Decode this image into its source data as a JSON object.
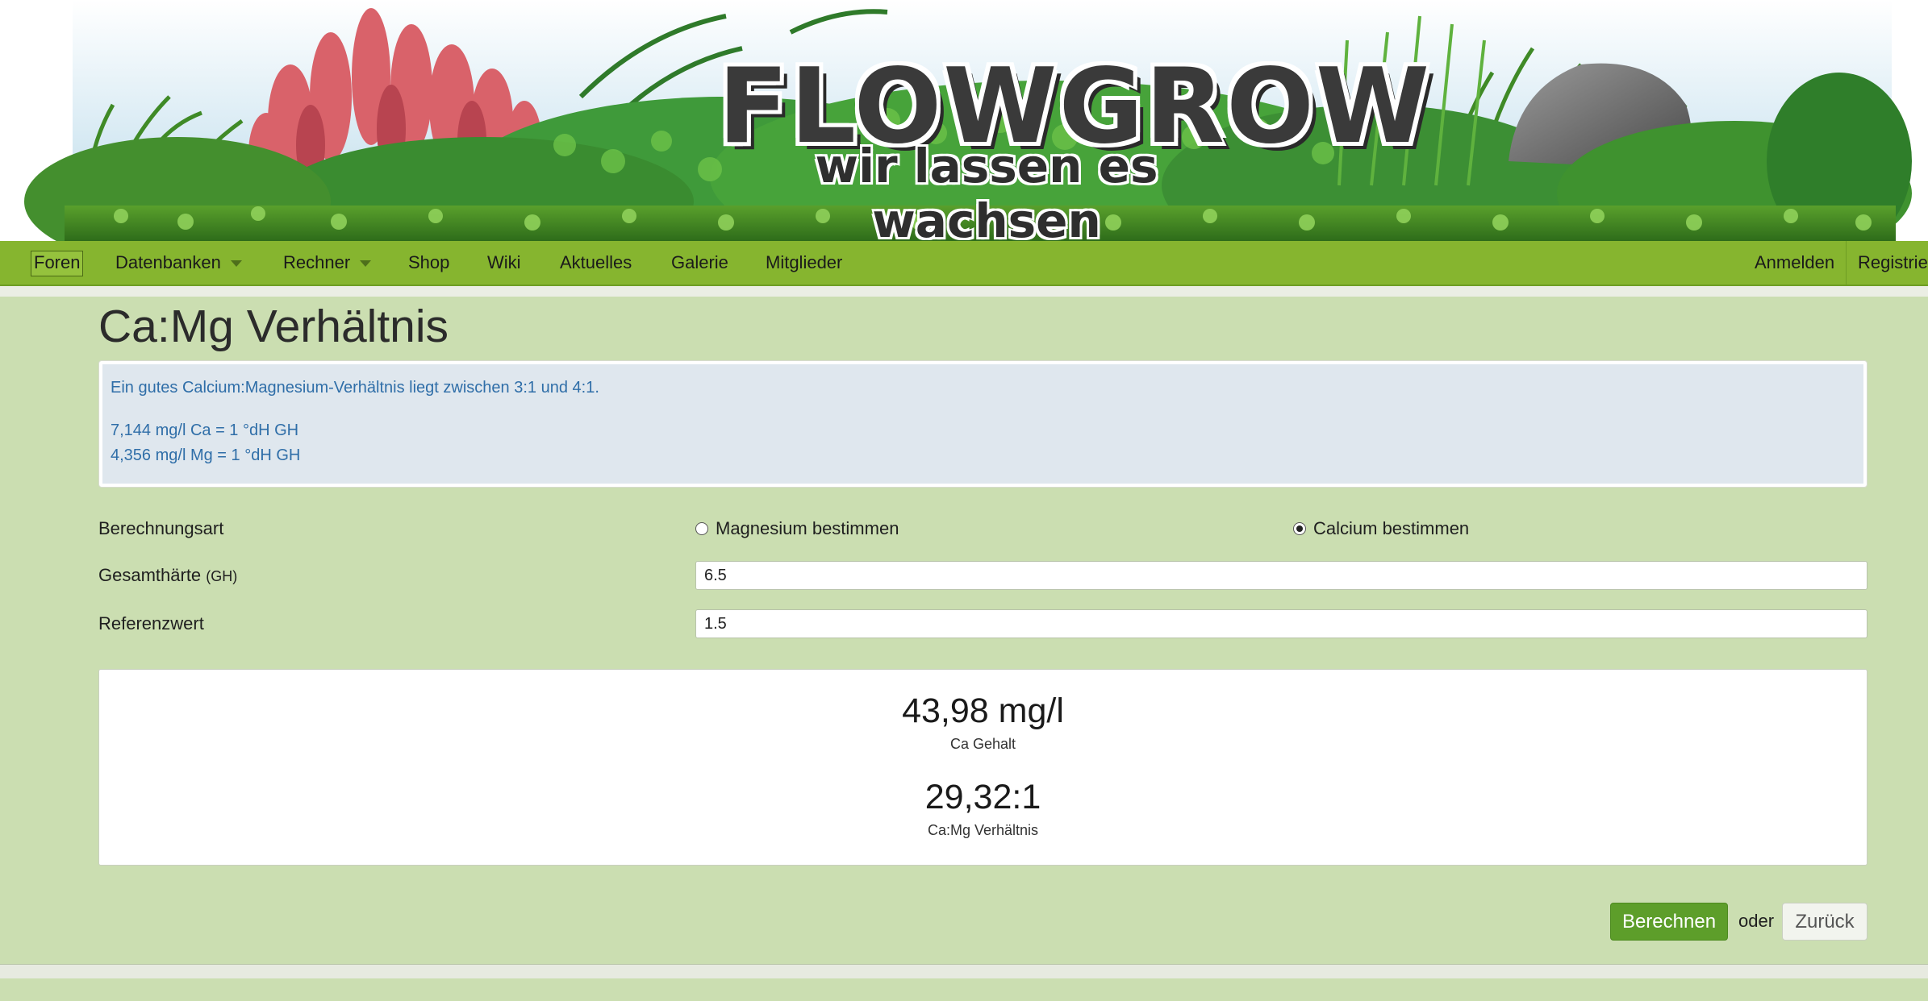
{
  "banner": {
    "logo_title": "FLOWGROW",
    "logo_subtitle": "wir lassen es wachsen"
  },
  "nav": {
    "items": [
      {
        "label": "Foren"
      },
      {
        "label": "Datenbanken"
      },
      {
        "label": "Rechner"
      },
      {
        "label": "Shop"
      },
      {
        "label": "Wiki"
      },
      {
        "label": "Aktuelles"
      },
      {
        "label": "Galerie"
      },
      {
        "label": "Mitglieder"
      }
    ],
    "login": "Anmelden",
    "register": "Registrier"
  },
  "page": {
    "title": "Ca:Mg Verhältnis"
  },
  "info": {
    "line1": "Ein gutes Calcium:Magnesium-Verhältnis liegt zwischen 3:1 und 4:1.",
    "line2": "7,144 mg/l Ca = 1 °dH GH",
    "line3": "4,356 mg/l Mg = 1 °dH GH"
  },
  "form": {
    "calc_type_label": "Berechnungsart",
    "option_magnesium": "Magnesium bestimmen",
    "option_calcium": "Calcium bestimmen",
    "selected": "Calcium bestimmen",
    "gh_label": "Gesamthärte",
    "gh_unit": "(GH)",
    "gh_value": "6.5",
    "ref_label": "Referenzwert",
    "ref_value": "1.5"
  },
  "results": {
    "value1": "43,98 mg/l",
    "label1": "Ca Gehalt",
    "value2": "29,32:1",
    "label2": "Ca:Mg Verhältnis"
  },
  "actions": {
    "calculate": "Berechnen",
    "or": "oder",
    "back": "Zurück"
  },
  "colors": {
    "nav_green": "#86b52f",
    "page_bg": "#cbdeb1",
    "button_green": "#5d9e2a",
    "info_text": "#2f6ea8"
  }
}
